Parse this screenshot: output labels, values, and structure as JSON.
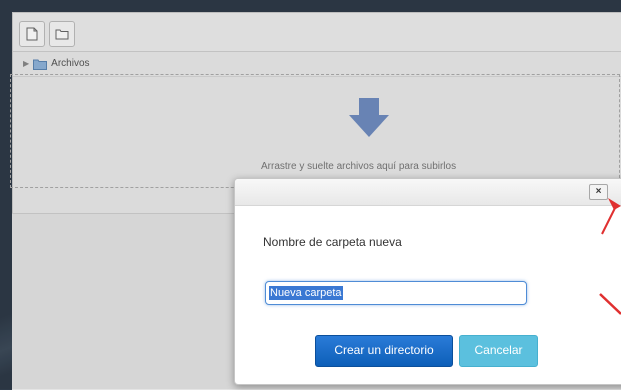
{
  "toolbar": {
    "new_file_icon": "file-icon",
    "new_folder_icon": "folder-icon"
  },
  "breadcrumb": {
    "label": "Archivos"
  },
  "dropzone": {
    "text": "Arrastre y suelte archivos aquí para subirlos"
  },
  "dialog": {
    "close_label": "×",
    "label": "Nombre de carpeta nueva",
    "input_value": "Nueva carpeta",
    "create_label": "Crear un directorio",
    "cancel_label": "Cancelar"
  },
  "colors": {
    "primary": "#0d5fb8",
    "cancel": "#5bc0de",
    "annotation": "#e03030"
  }
}
